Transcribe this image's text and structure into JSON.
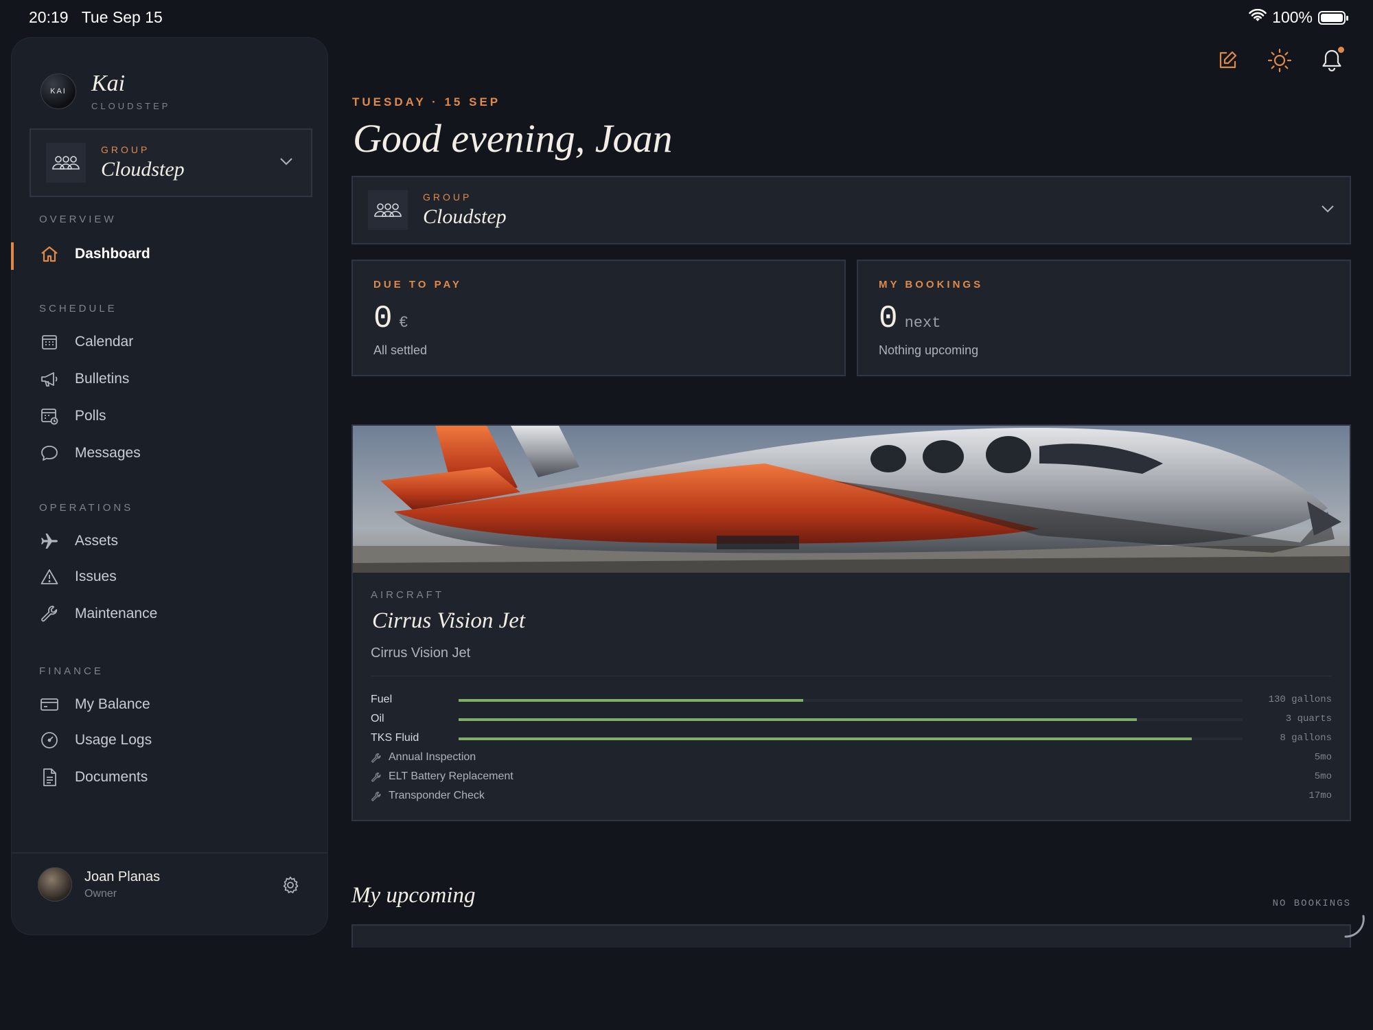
{
  "status_bar": {
    "time": "20:19",
    "date": "Tue Sep 15",
    "battery": "100%"
  },
  "sidebar": {
    "brand": {
      "name": "Kai",
      "subtitle": "CLOUDSTEP",
      "logo_text": "KAI"
    },
    "group": {
      "label": "GROUP",
      "name": "Cloudstep"
    },
    "sections": {
      "overview": "OVERVIEW",
      "schedule": "SCHEDULE",
      "operations": "OPERATIONS",
      "finance": "FINANCE"
    },
    "items": {
      "dashboard": "Dashboard",
      "calendar": "Calendar",
      "bulletins": "Bulletins",
      "polls": "Polls",
      "messages": "Messages",
      "assets": "Assets",
      "issues": "Issues",
      "maintenance": "Maintenance",
      "my_balance": "My Balance",
      "usage_logs": "Usage Logs",
      "documents": "Documents"
    },
    "user": {
      "name": "Joan Planas",
      "role": "Owner"
    }
  },
  "main": {
    "date_line": "TUESDAY · 15 SEP",
    "greeting": "Good evening, Joan",
    "group": {
      "label": "GROUP",
      "name": "Cloudstep"
    },
    "due_to_pay": {
      "label": "DUE TO PAY",
      "value": "0",
      "unit": "€",
      "sub": "All settled"
    },
    "my_bookings": {
      "label": "MY BOOKINGS",
      "value": "0",
      "unit": "next",
      "sub": "Nothing upcoming"
    },
    "aircraft": {
      "label": "AIRCRAFT",
      "title": "Cirrus Vision Jet",
      "subtitle": "Cirrus Vision Jet",
      "gauges": [
        {
          "name": "Fuel",
          "value": "130 gallons",
          "level": 0.44
        },
        {
          "name": "Oil",
          "value": "3 quarts",
          "level": 0.865
        },
        {
          "name": "TKS Fluid",
          "value": "8 gallons",
          "level": 0.935
        }
      ],
      "maintenance": [
        {
          "name": "Annual Inspection",
          "due": "5mo"
        },
        {
          "name": "ELT Battery Replacement",
          "due": "5mo"
        },
        {
          "name": "Transponder Check",
          "due": "17mo"
        }
      ]
    },
    "upcoming": {
      "title": "My upcoming",
      "badge": "NO BOOKINGS"
    }
  },
  "colors": {
    "accent": "#e08a4a",
    "background": "#12151b",
    "card": "#1e232c",
    "gauge": "#7fb069"
  }
}
